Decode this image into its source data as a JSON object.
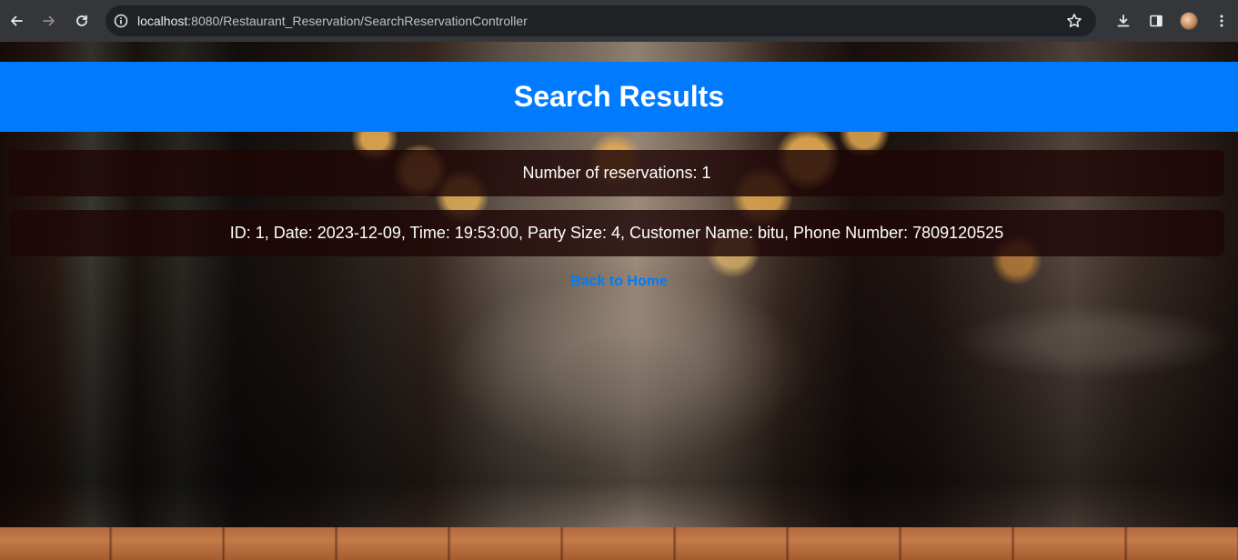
{
  "browser": {
    "url_host": "localhost",
    "url_rest": ":8080/Restaurant_Reservation/SearchReservationController"
  },
  "page": {
    "title": "Search Results",
    "count_text": "Number of reservations: 1",
    "results": [
      "ID: 1, Date: 2023-12-09, Time: 19:53:00, Party Size: 4, Customer Name: bitu, Phone Number: 7809120525"
    ],
    "back_link": "Back to Home"
  },
  "colors": {
    "header_bg": "#007bff",
    "link": "#007bff"
  }
}
